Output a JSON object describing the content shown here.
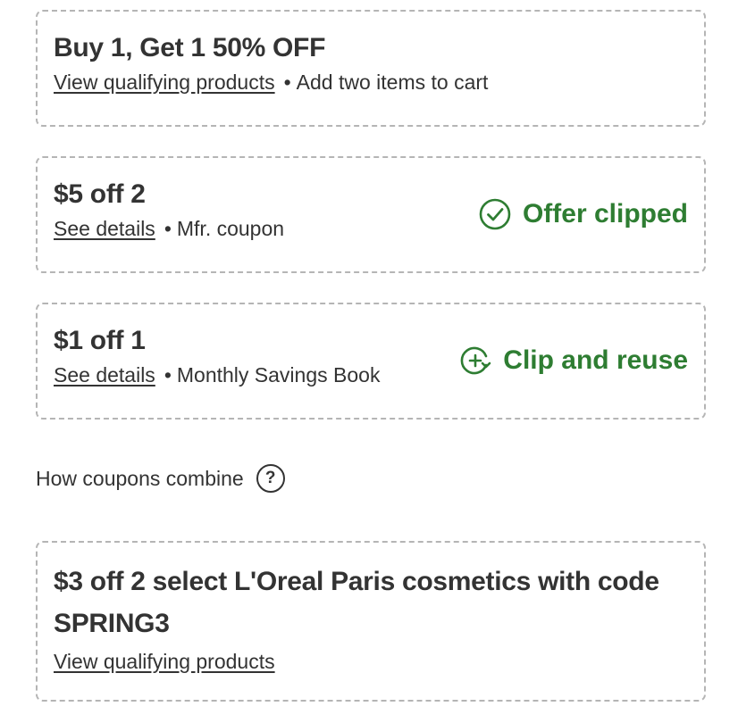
{
  "offers": [
    {
      "title": "Buy 1, Get 1 50% OFF",
      "link": "View qualifying products",
      "separator": "•",
      "note": "Add two items to cart"
    },
    {
      "title": "$5 off 2",
      "link": "See details",
      "separator": "•",
      "note": "Mfr. coupon",
      "action": {
        "label": "Offer clipped",
        "icon": "check-circle-icon"
      }
    },
    {
      "title": "$1 off 1",
      "link": "See details",
      "separator": "•",
      "note": "Monthly Savings Book",
      "action": {
        "label": "Clip and reuse",
        "icon": "reuse-clip-icon"
      }
    }
  ],
  "how_combine": {
    "label": "How coupons combine",
    "icon": "help-icon",
    "glyph": "?"
  },
  "promo": {
    "title": "$3 off 2 select L'Oreal Paris cosmetics with code SPRING3",
    "link": "View qualifying products"
  },
  "colors": {
    "accent": "#2e7d32",
    "text": "#333333",
    "border": "#b5b5b5"
  }
}
